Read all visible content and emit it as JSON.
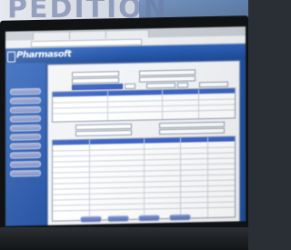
{
  "wall": {
    "sign_text": "PEDITION"
  },
  "browser": {
    "tabs": [
      "",
      "",
      ""
    ]
  },
  "app": {
    "logo": "Pharmasoft",
    "sidebar_buttons": 10
  },
  "colors": {
    "app_blue": "#1f4fa0",
    "field_blue": "#3a63c6",
    "sidebar_button": "#8b99cc"
  }
}
